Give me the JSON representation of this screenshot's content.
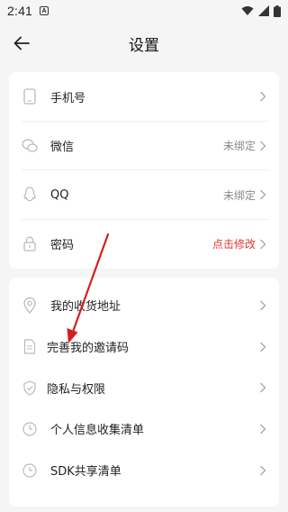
{
  "status_bar": {
    "time": "2:41",
    "notification_glyph": "A"
  },
  "header": {
    "title": "设置"
  },
  "account_section": [
    {
      "label": "手机号",
      "value": "",
      "icon": "phone-icon"
    },
    {
      "label": "微信",
      "value": "未绑定",
      "icon": "wechat-icon"
    },
    {
      "label": "QQ",
      "value": "未绑定",
      "icon": "qq-icon"
    },
    {
      "label": "密码",
      "value": "点击修改",
      "icon": "lock-icon",
      "value_color": "#e0392a"
    }
  ],
  "other_section": [
    {
      "label": "我的收货地址",
      "icon": "location-icon"
    },
    {
      "label": "完善我的邀请码",
      "icon": "document-icon"
    },
    {
      "label": "隐私与权限",
      "icon": "shield-icon"
    },
    {
      "label": "个人信息收集清单",
      "icon": "clock-icon"
    },
    {
      "label": "SDK共享清单",
      "icon": "clock-icon"
    }
  ],
  "colors": {
    "accent_red": "#e0392a",
    "annotation_arrow": "#d42020"
  }
}
